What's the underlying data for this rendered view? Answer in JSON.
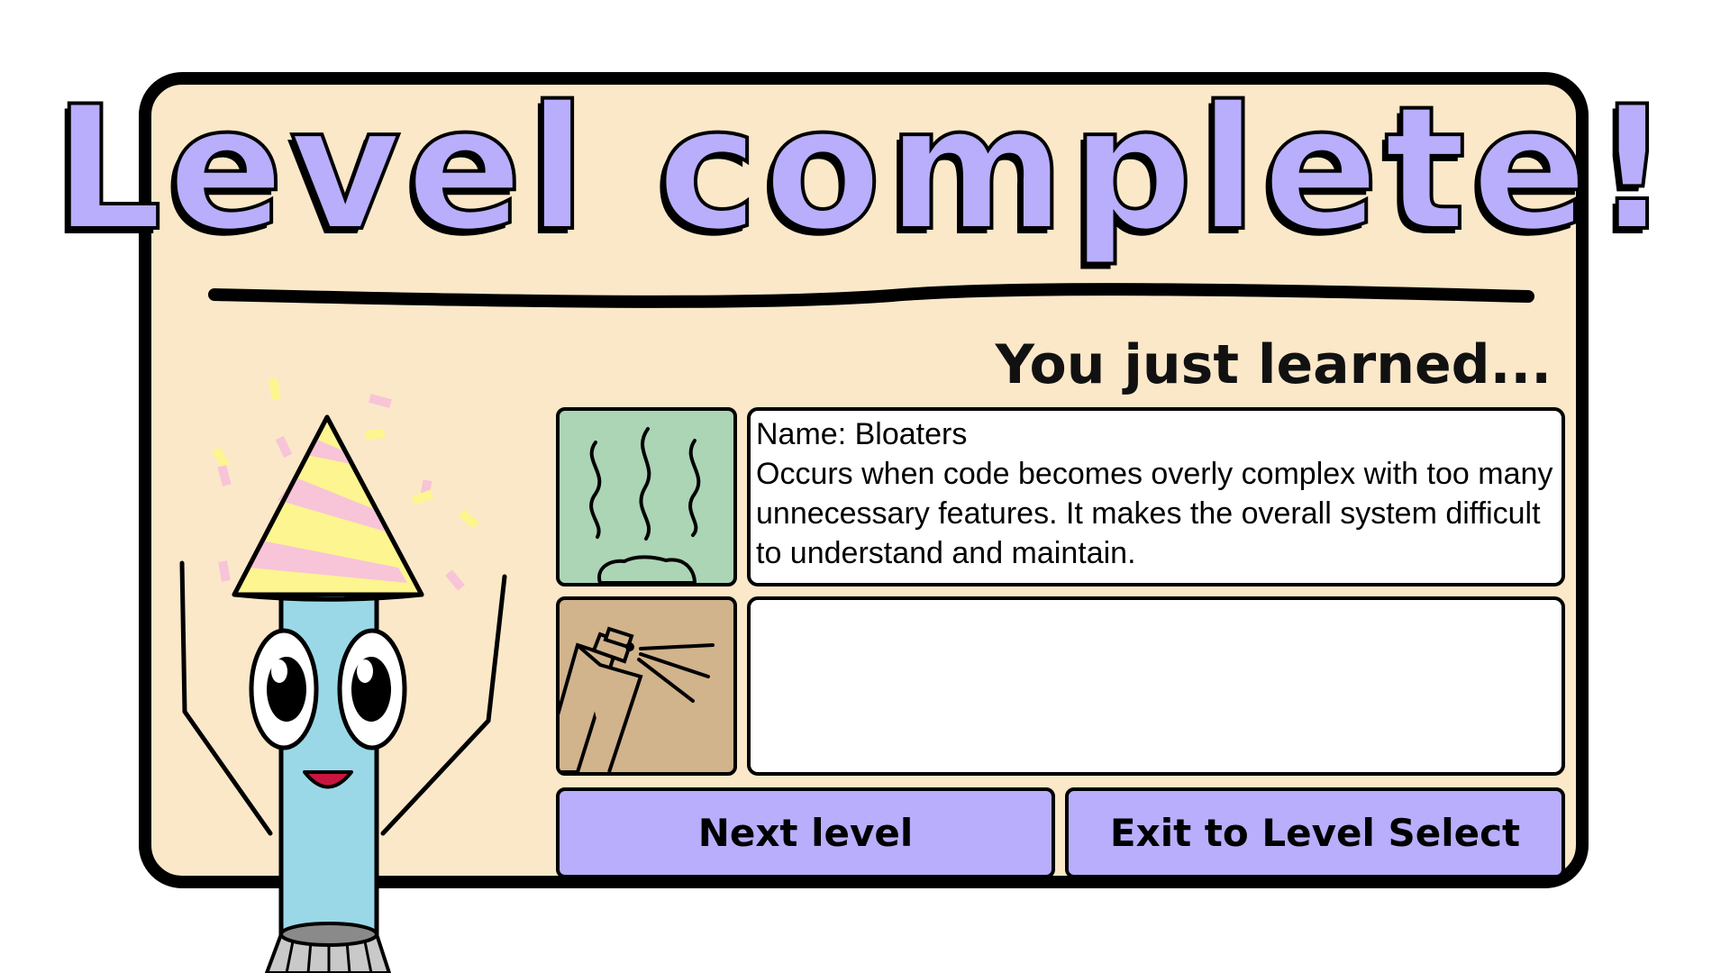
{
  "title": "Level complete!",
  "subtitle": "You just learned...",
  "cards": [
    {
      "icon": "smell-icon",
      "name_line": "Name: Bloaters",
      "description": "Occurs when code becomes overly complex with too many unnecessary features. It makes the overall system difficult to understand and maintain."
    },
    {
      "icon": "spray-can-icon",
      "name_line": "",
      "description": ""
    }
  ],
  "buttons": {
    "next_label": "Next level",
    "exit_label": "Exit to Level Select"
  },
  "colors": {
    "panel": "#fbe8c9",
    "accent": "#b8aefb",
    "smell_tile": "#abd5b5",
    "spray_tile": "#d1b38c",
    "mascot_body": "#9ad8e8"
  }
}
